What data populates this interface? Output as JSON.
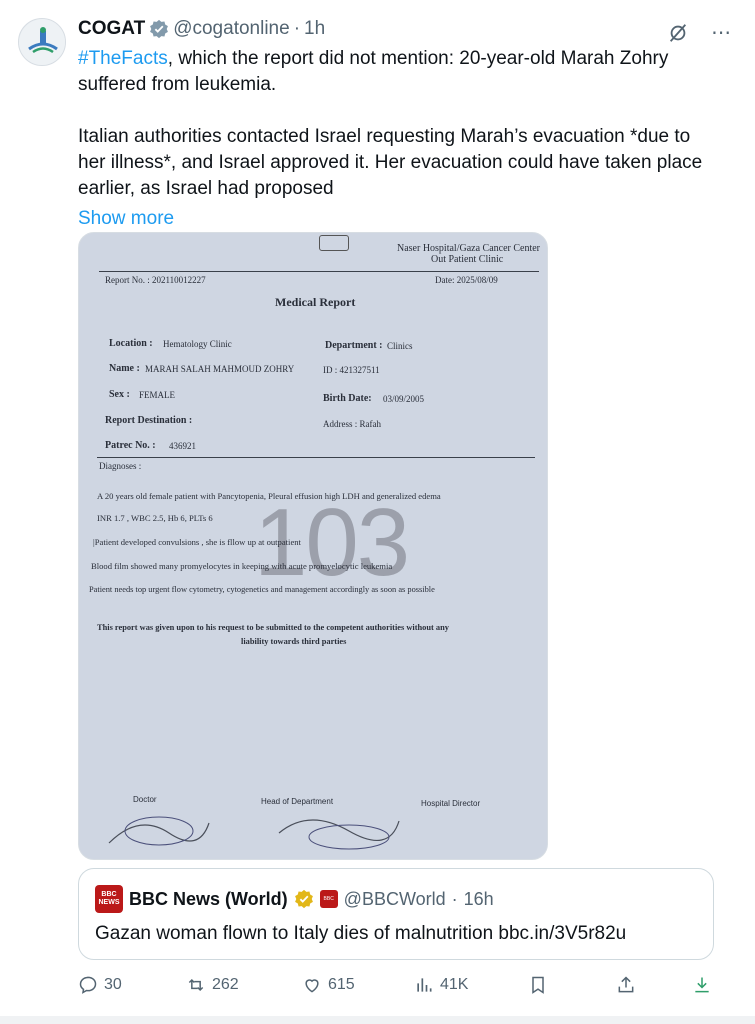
{
  "post": {
    "author_name": "COGAT",
    "handle": "@cogatonline",
    "time": "1h",
    "hashtag": "#TheFacts",
    "line1_rest": ", which the report did not mention: 20-year-old Marah Zohry suffered from leukemia.",
    "para2": "Italian authorities contacted Israel requesting Marah’s evacuation *due to her illness*, and Israel approved it. Her evacuation could have taken place earlier, as Israel had proposed",
    "show_more": "Show more"
  },
  "document": {
    "hospital_en_1": "Naser Hospital/Gaza Cancer Center",
    "hospital_en_2": "Out Patient Clinic",
    "report_no": "Report No. : 202110012227",
    "date": "Date: 2025/08/09",
    "title": "Medical Report",
    "location_label": "Location :",
    "location_value": "Hematology Clinic",
    "department_label": "Department :",
    "department_value": "Clinics",
    "name_label": "Name :",
    "name_value": "MARAH SALAH MAHMOUD ZOHRY",
    "id_value": "ID : 421327511",
    "sex_label": "Sex :",
    "sex_value": "FEMALE",
    "birth_label": "Birth Date:",
    "birth_value": "03/09/2005",
    "dest_label": "Report Destination :",
    "address_value": "Address : Rafah",
    "patrec_label": "Patrec No. :",
    "patrec_value": "436921",
    "diagnoses": "Diagnoses :",
    "diag_1": "A 20 years old female patient with Pancytopenia, Pleural effusion high LDH and generalized edema",
    "diag_2": "INR 1.7 , WBC 2.5, Hb 6, PLTs 6",
    "diag_3": "|Patient developed convulsions , she is fllow up at outpatient",
    "diag_4": "Blood film showed many promyelocytes in keeping with acute promyelocytic leukemia",
    "diag_5": "Patient needs top urgent flow cytometry, cytogenetics and management accordingly as soon as possible",
    "notice_1": "This report was given upon to his request to be submitted to the competent authorities without any",
    "notice_2": "liability towards third parties",
    "doctor": "Doctor",
    "head_dept": "Head of Department",
    "hospital_director": "Hospital Director",
    "watermark": "103"
  },
  "quote": {
    "author_name": "BBC News (World)",
    "handle": "@BBCWorld",
    "time": "16h",
    "text": "Gazan woman flown to Italy dies of malnutrition bbc.in/3V5r82u"
  },
  "actions": {
    "replies": "30",
    "reposts": "262",
    "likes": "615",
    "views": "41K"
  },
  "colors": {
    "accent": "#1d9bf0",
    "muted": "#536471",
    "verified_gold": "#e2b719",
    "bbc_red": "#bb1919"
  }
}
